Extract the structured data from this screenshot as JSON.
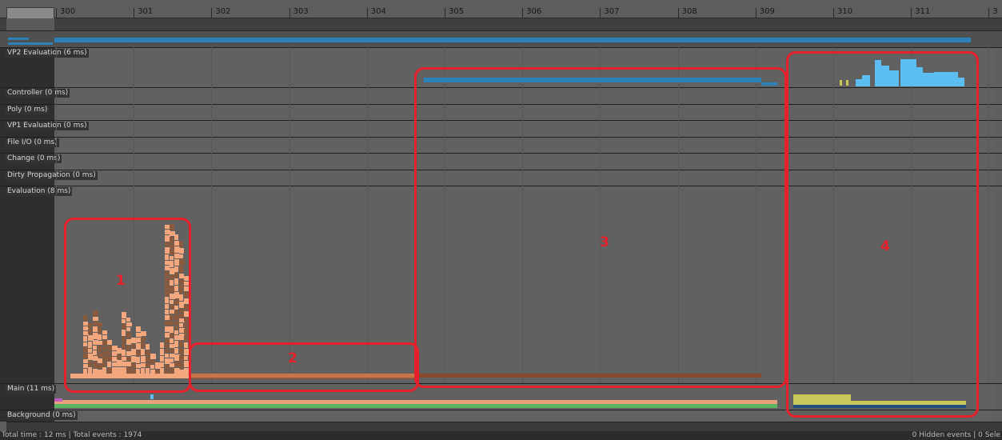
{
  "ruler": {
    "ticks": [
      "300",
      "301",
      "302",
      "303",
      "304",
      "305",
      "306",
      "307",
      "308",
      "309",
      "310",
      "311",
      "3"
    ]
  },
  "rows": [
    {
      "id": "vp2",
      "label": "VP2 Evaluation (6 ms)"
    },
    {
      "id": "controller",
      "label": "Controller (0 ms)"
    },
    {
      "id": "poly",
      "label": "Poly (0 ms)"
    },
    {
      "id": "vp1",
      "label": "VP1 Evaluation (0 ms)"
    },
    {
      "id": "fileio",
      "label": "File I/O (0 ms)"
    },
    {
      "id": "change",
      "label": "Change (0 ms)"
    },
    {
      "id": "dirty",
      "label": "Dirty Propagation (0 ms)"
    },
    {
      "id": "evaluation",
      "label": "Evaluation (8 ms)"
    },
    {
      "id": "main",
      "label": "Main (11 ms)"
    },
    {
      "id": "background",
      "label": "Background (0 ms)"
    }
  ],
  "annotations": [
    "1",
    "2",
    "3",
    "4"
  ],
  "status": {
    "left": "Total time : 12 ms | Total events : 1974",
    "right": "0 Hidden events | 0 Sele"
  },
  "colors": {
    "marker": "#e6202a",
    "evaluation_light": "#f4a77d",
    "evaluation_dark": "#8a5a3f",
    "vp2_dark": "#2a82b8",
    "vp2_light": "#5bbdf0",
    "main_peach": "#e8a17c",
    "main_green": "#5bb562",
    "main_yellow": "#c8c85a"
  }
}
